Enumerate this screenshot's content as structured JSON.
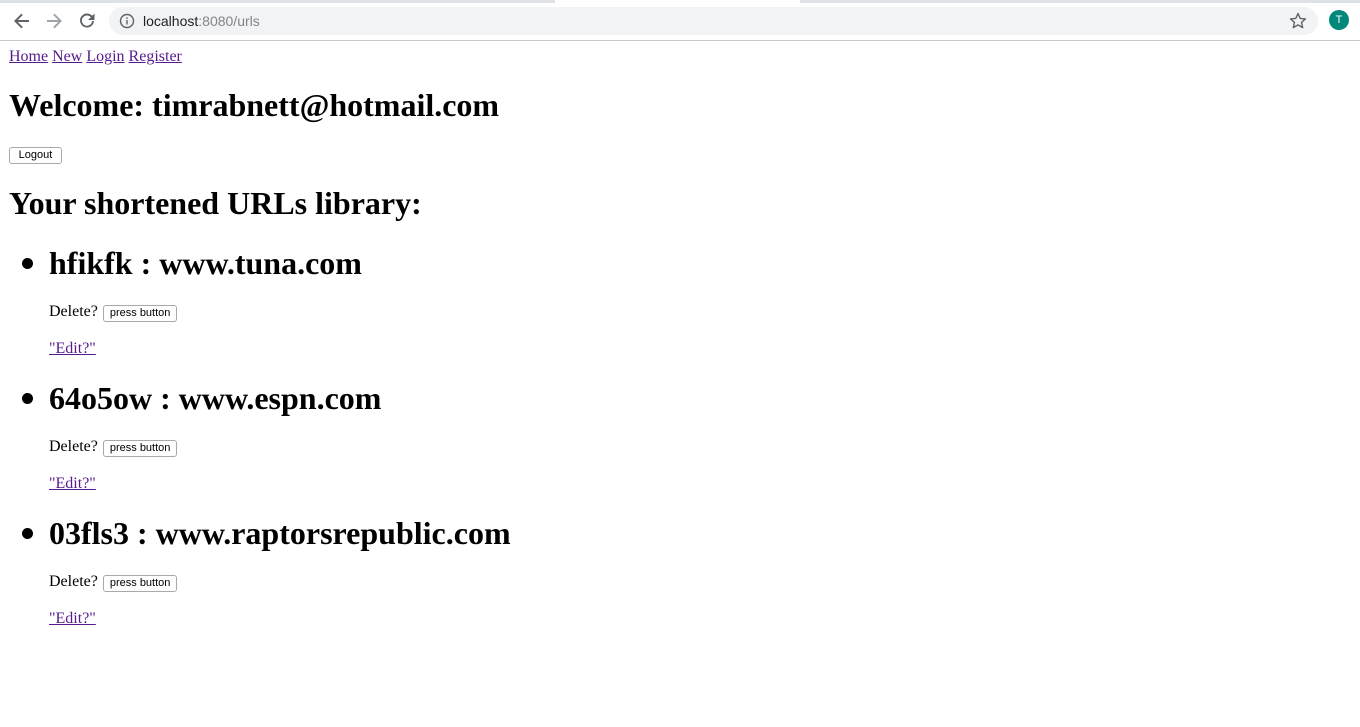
{
  "browser": {
    "url_host": "localhost",
    "url_path": ":8080/urls",
    "profile_initial": "T"
  },
  "nav": {
    "home": "Home",
    "new": "New",
    "login": "Login",
    "register": "Register"
  },
  "welcome": "Welcome: timrabnett@hotmail.com",
  "logout_label": "Logout",
  "library_title": "Your shortened URLs library:",
  "urls": [
    {
      "title": "hfikfk : www.tuna.com",
      "delete_label": "Delete?",
      "delete_button": "press button",
      "edit_label": "\"Edit?\""
    },
    {
      "title": "64o5ow : www.espn.com",
      "delete_label": "Delete?",
      "delete_button": "press button",
      "edit_label": "\"Edit?\""
    },
    {
      "title": "03fls3 : www.raptorsrepublic.com",
      "delete_label": "Delete?",
      "delete_button": "press button",
      "edit_label": "\"Edit?\""
    }
  ],
  "colors": {
    "visited_link": "#551a8b",
    "avatar": "#00897b",
    "omnibox": "#f1f3f4"
  }
}
